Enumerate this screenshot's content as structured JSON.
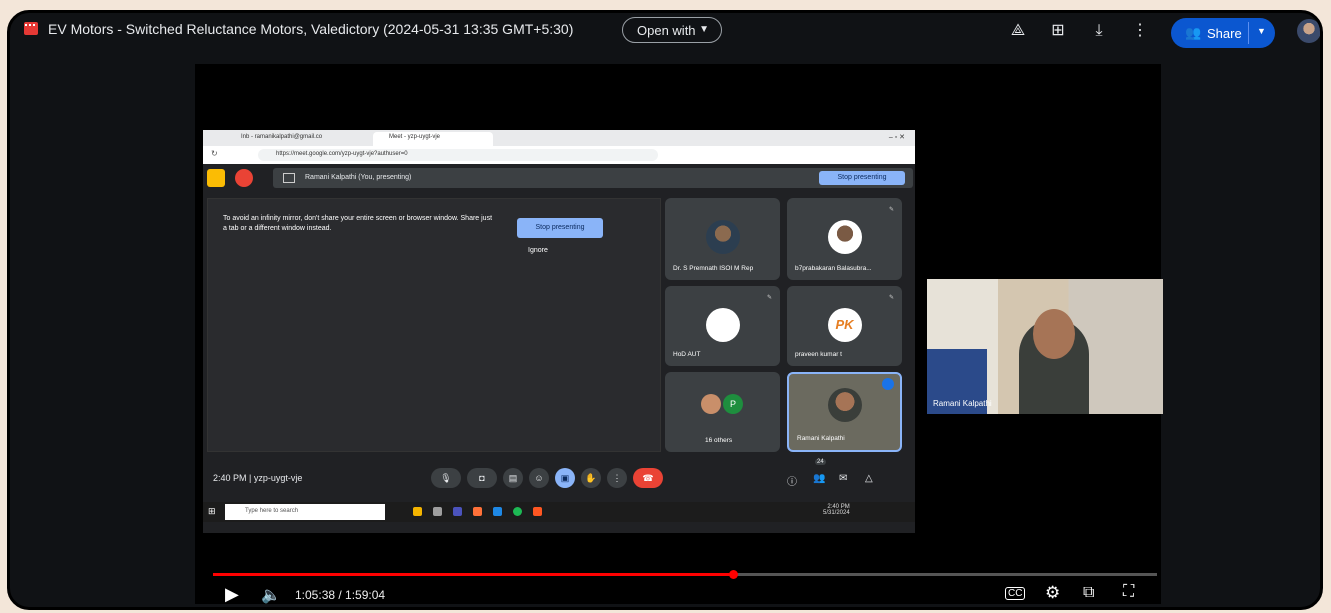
{
  "header": {
    "title": "EV Motors - Switched Reluctance Motors, Valedictory (2024-05-31 13:35 GMT+5:30)",
    "open_with": "Open with",
    "share": "Share",
    "icons": [
      "add-to-drive-icon",
      "add-note-icon",
      "download-icon",
      "more-vert-icon"
    ]
  },
  "video": {
    "browser": {
      "tab1": "Inb - ramanikalpathi@gmail.co",
      "tab2": "Meet - yzp-uygt-vje",
      "url": "https://meet.google.com/yzp-uygt-vje?authuser=0"
    },
    "meet": {
      "presenting_label": "Ramani Kalpathi (You, presenting)",
      "stop_presenting": "Stop presenting",
      "warning": "To avoid an infinity mirror, don't share your entire screen or browser window. Share just a tab or a different window instead.",
      "ignore": "Ignore",
      "tiles": [
        {
          "name": "Dr. S Premnath ISOI M Rep"
        },
        {
          "name": "b7prabakaran Balasubra..."
        },
        {
          "name": "HoD AUT"
        },
        {
          "name": "praveen kumar t"
        },
        {
          "name": "16 others"
        },
        {
          "name": "Ramani Kalpathi"
        }
      ],
      "avatar_letter": "P",
      "pk_logo": "PK",
      "time_code": "2:40 PM  |  yzp-uygt-vje",
      "participants_count": "24",
      "taskbar_search": "Type here to search",
      "taskbar_time": "2:40 PM",
      "taskbar_date": "5/31/2024"
    },
    "camera_name": "Ramani Kalpathi"
  },
  "player": {
    "time": "1:05:38 / 1:59:04",
    "progress": 0.551
  }
}
